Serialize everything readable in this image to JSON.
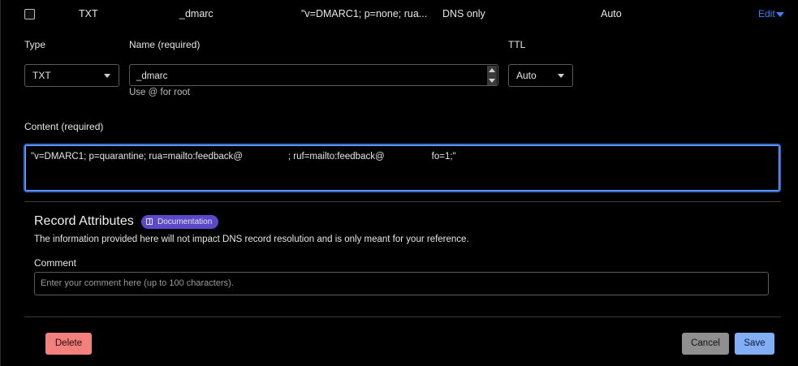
{
  "record_row": {
    "type": "TXT",
    "name": "_dmarc",
    "content_preview": "\"v=DMARC1; p=none; rua...",
    "proxy_status": "DNS only",
    "ttl": "Auto",
    "edit_label": "Edit"
  },
  "form": {
    "type_label": "Type",
    "type_value": "TXT",
    "name_label": "Name (required)",
    "name_value": "_dmarc",
    "name_hint": "Use @ for root",
    "ttl_label": "TTL",
    "ttl_value": "Auto",
    "content_label": "Content (required)",
    "content_part1": "\"v=DMARC1; p=quarantine; rua=mailto:feedback@",
    "content_part2": "; ruf=mailto:feedback@",
    "content_part3": "fo=1;\""
  },
  "attributes": {
    "title": "Record Attributes",
    "doc_badge": "Documentation",
    "description": "The information provided here will not impact DNS record resolution and is only meant for your reference.",
    "comment_label": "Comment",
    "comment_placeholder": "Enter your comment here (up to 100 characters)."
  },
  "actions": {
    "delete": "Delete",
    "cancel": "Cancel",
    "save": "Save"
  },
  "colors": {
    "accent": "#3b82f6",
    "delete": "#f2807d",
    "save": "#82aef5",
    "badge": "#5b49c9"
  }
}
